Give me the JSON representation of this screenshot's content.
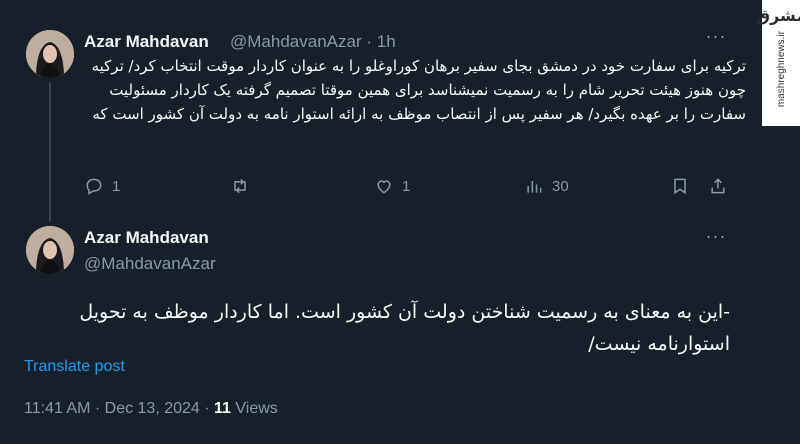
{
  "tweet1": {
    "name": "Azar Mahdavan",
    "handle": "@MahdavanAzar",
    "separator": "·",
    "time": "1h",
    "text": "ترکیه برای سفارت خود در دمشق بجای سفیر برهان کوراوغلو را به عنوان کاردار موقت انتخاب کرد/ ترکیه چون هنوز هیئت تحریر شام را به رسمیت نمیشناسد برای همین موقتا تصمیم گرفته یک کاردار مسئولیت سفارت را بر عهده بگیرد/ هر سفیر پس از انتصاب موظف به ارائه استوار نامه به دولت آن کشور است که",
    "actions": {
      "reply_count": "1",
      "repost_count": "",
      "like_count": "1",
      "views_count": "30"
    }
  },
  "tweet2": {
    "name": "Azar Mahdavan",
    "handle": "@MahdavanAzar",
    "text": "-این به معنای به رسمیت شناختن دولت آن کشور است. اما کاردار موظف به تحویل استوارنامه نیست/",
    "translate_label": "Translate post",
    "timestamp": "11:41 AM · Dec 13, 2024 · ",
    "views_number": "11",
    "views_label": " Views"
  },
  "watermark": {
    "logo_text": "مشرق",
    "url": "mashreghnews.ir"
  },
  "icons": [
    "more-icon",
    "reply-icon",
    "repost-icon",
    "like-icon",
    "views-icon",
    "bookmark-icon",
    "share-icon"
  ],
  "colors": {
    "background": "#15202b",
    "text": "#f7f9f9",
    "muted": "#8b98a5",
    "accent": "#1d9bf0"
  }
}
